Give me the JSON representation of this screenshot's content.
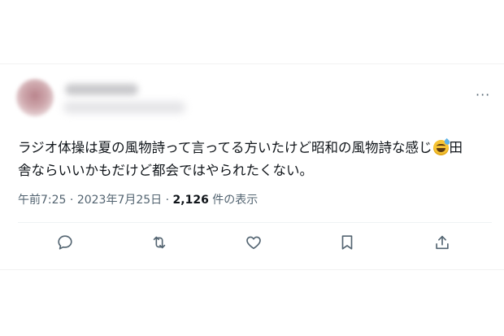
{
  "tweet": {
    "text_line1": "ラジオ体操は夏の風物詩って言ってる方いたけど昭和の風物詩な感じ",
    "text_line1_tail": "田",
    "text_line2": "舎ならいいかもだけど都会ではやられたくない。",
    "emoji": "grinning-face-with-sweat",
    "time": "午前7:25",
    "separator": "·",
    "date": "2023年7月25日",
    "views_count": "2,126",
    "views_label": "件の表示",
    "more_label": "···"
  },
  "actions": [
    {
      "name": "reply",
      "icon": "reply-icon"
    },
    {
      "name": "retweet",
      "icon": "retweet-icon"
    },
    {
      "name": "like",
      "icon": "heart-icon"
    },
    {
      "name": "bookmark",
      "icon": "bookmark-icon"
    },
    {
      "name": "share",
      "icon": "share-icon"
    }
  ],
  "colors": {
    "text": "#0f1419",
    "secondary": "#536471",
    "divider": "#eff3f4"
  }
}
